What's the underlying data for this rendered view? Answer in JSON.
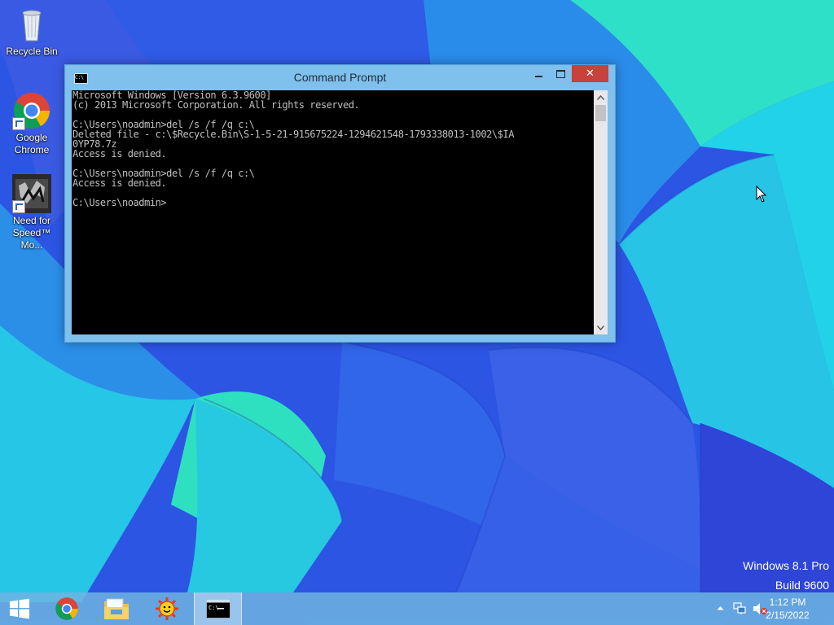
{
  "desktop": {
    "icons": [
      {
        "label_lines": [
          "Recycle Bin"
        ],
        "icon": "recycle-bin-icon"
      },
      {
        "label_lines": [
          "Google",
          "Chrome"
        ],
        "icon": "chrome-icon"
      },
      {
        "label_lines": [
          "Need for",
          "Speed™ Mo..."
        ],
        "icon": "nfs-most-wanted-icon"
      }
    ]
  },
  "window": {
    "title": "Command Prompt",
    "close_glyph": "✕",
    "console_lines": [
      "Microsoft Windows [Version 6.3.9600]",
      "(c) 2013 Microsoft Corporation. All rights reserved.",
      "",
      "C:\\Users\\noadmin>del /s /f /q c:\\",
      "Deleted file - c:\\$Recycle.Bin\\S-1-5-21-915675224-1294621548-1793338013-1002\\$IA",
      "0YP78.7z",
      "Access is denied.",
      "",
      "C:\\Users\\noadmin>del /s /f /q c:\\",
      "Access is denied.",
      "",
      "C:\\Users\\noadmin>"
    ]
  },
  "taskbar": {
    "apps": [
      "start-icon",
      "chrome-icon",
      "file-explorer-icon",
      "sun-app-icon",
      "command-prompt-icon"
    ],
    "tray": [
      "show-hidden-icons-icon",
      "network-icon",
      "volume-muted-icon"
    ],
    "time": "1:12 PM",
    "date": "2/15/2022"
  },
  "watermark": {
    "line1": "Windows 8.1 Pro",
    "line2": "Build 9600"
  },
  "colors": {
    "titlebar": "#7fc0ec",
    "close": "#c7413d",
    "console_bg": "#000000",
    "console_text": "#c0c0c0"
  }
}
